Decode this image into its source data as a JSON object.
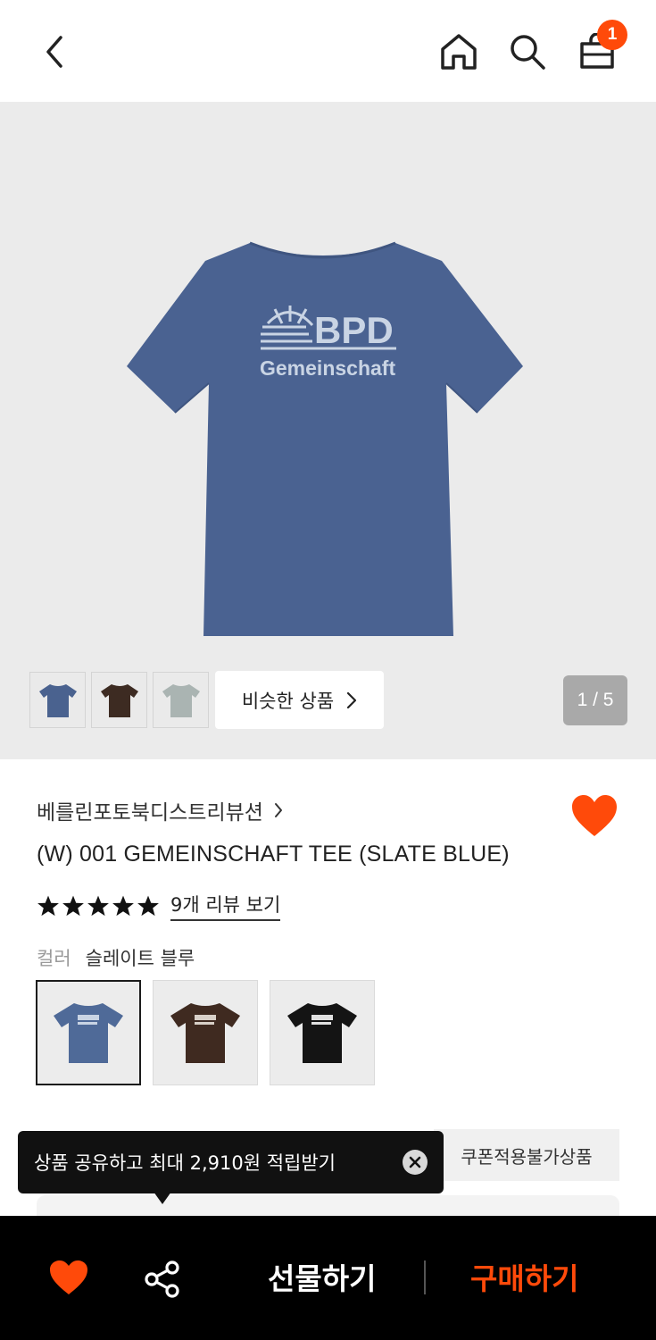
{
  "header": {
    "back_icon": "chevron-left-icon",
    "home_icon": "home-icon",
    "search_icon": "search-icon",
    "cart_icon": "shopping-bag-icon",
    "cart_count": "1"
  },
  "gallery": {
    "shirt_print_line1": "BPD",
    "shirt_print_line2": "Gemeinschaft",
    "thumbnail_colors": [
      "#4a628f",
      "#3d2b22",
      "#aab4b2"
    ],
    "similar_label": "비슷한 상품",
    "page_indicator": "1 / 5"
  },
  "product": {
    "brand": "베를린포토북디스트리뷰션",
    "title": "(W) 001 GEMEINSCHAFT TEE (SLATE BLUE)",
    "rating_stars": 5,
    "reviews_link": "9개 리뷰 보기",
    "color_label": "컬러",
    "color_value": "슬레이트 블루",
    "swatches": [
      {
        "color": "#4f6a98",
        "selected": true
      },
      {
        "color": "#3f2a20",
        "selected": false
      },
      {
        "color": "#141414",
        "selected": false
      }
    ]
  },
  "coupon_tag": "쿠폰적용불가상품",
  "tooltip": {
    "text": "상품 공유하고 최대 2,910원 적립받기"
  },
  "bottom_bar": {
    "gift_label": "선물하기",
    "buy_label": "구매하기"
  },
  "colors": {
    "accent": "#ff4a0a",
    "hero_bg": "#ebebeb",
    "bottom_bar_bg": "#000000"
  }
}
